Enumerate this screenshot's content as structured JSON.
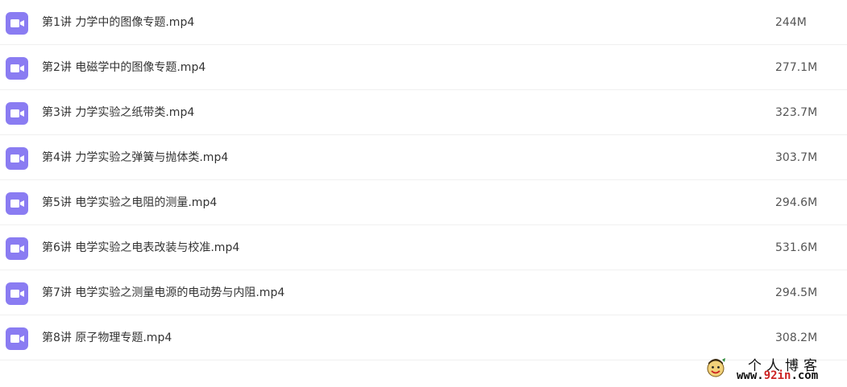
{
  "colors": {
    "icon_bg": "#8a7cf2",
    "text": "#333333",
    "divider": "#f0f0f0"
  },
  "files": [
    {
      "icon": "video-file-icon",
      "name": "第1讲 力学中的图像专题.mp4",
      "size": "244M"
    },
    {
      "icon": "video-file-icon",
      "name": "第2讲 电磁学中的图像专题.mp4",
      "size": "277.1M"
    },
    {
      "icon": "video-file-icon",
      "name": "第3讲 力学实验之纸带类.mp4",
      "size": "323.7M"
    },
    {
      "icon": "video-file-icon",
      "name": "第4讲 力学实验之弹簧与抛体类.mp4",
      "size": "303.7M"
    },
    {
      "icon": "video-file-icon",
      "name": "第5讲 电学实验之电阻的测量.mp4",
      "size": "294.6M"
    },
    {
      "icon": "video-file-icon",
      "name": "第6讲 电学实验之电表改装与校准.mp4",
      "size": "531.6M"
    },
    {
      "icon": "video-file-icon",
      "name": "第7讲 电学实验之测量电源的电动势与内阻.mp4",
      "size": "294.5M"
    },
    {
      "icon": "video-file-icon",
      "name": "第8讲 原子物理专题.mp4",
      "size": "308.2M"
    }
  ],
  "watermark": {
    "title": "个人博客",
    "url_prefix": "www.",
    "url_accent": "92in",
    "url_suffix": ".com"
  }
}
